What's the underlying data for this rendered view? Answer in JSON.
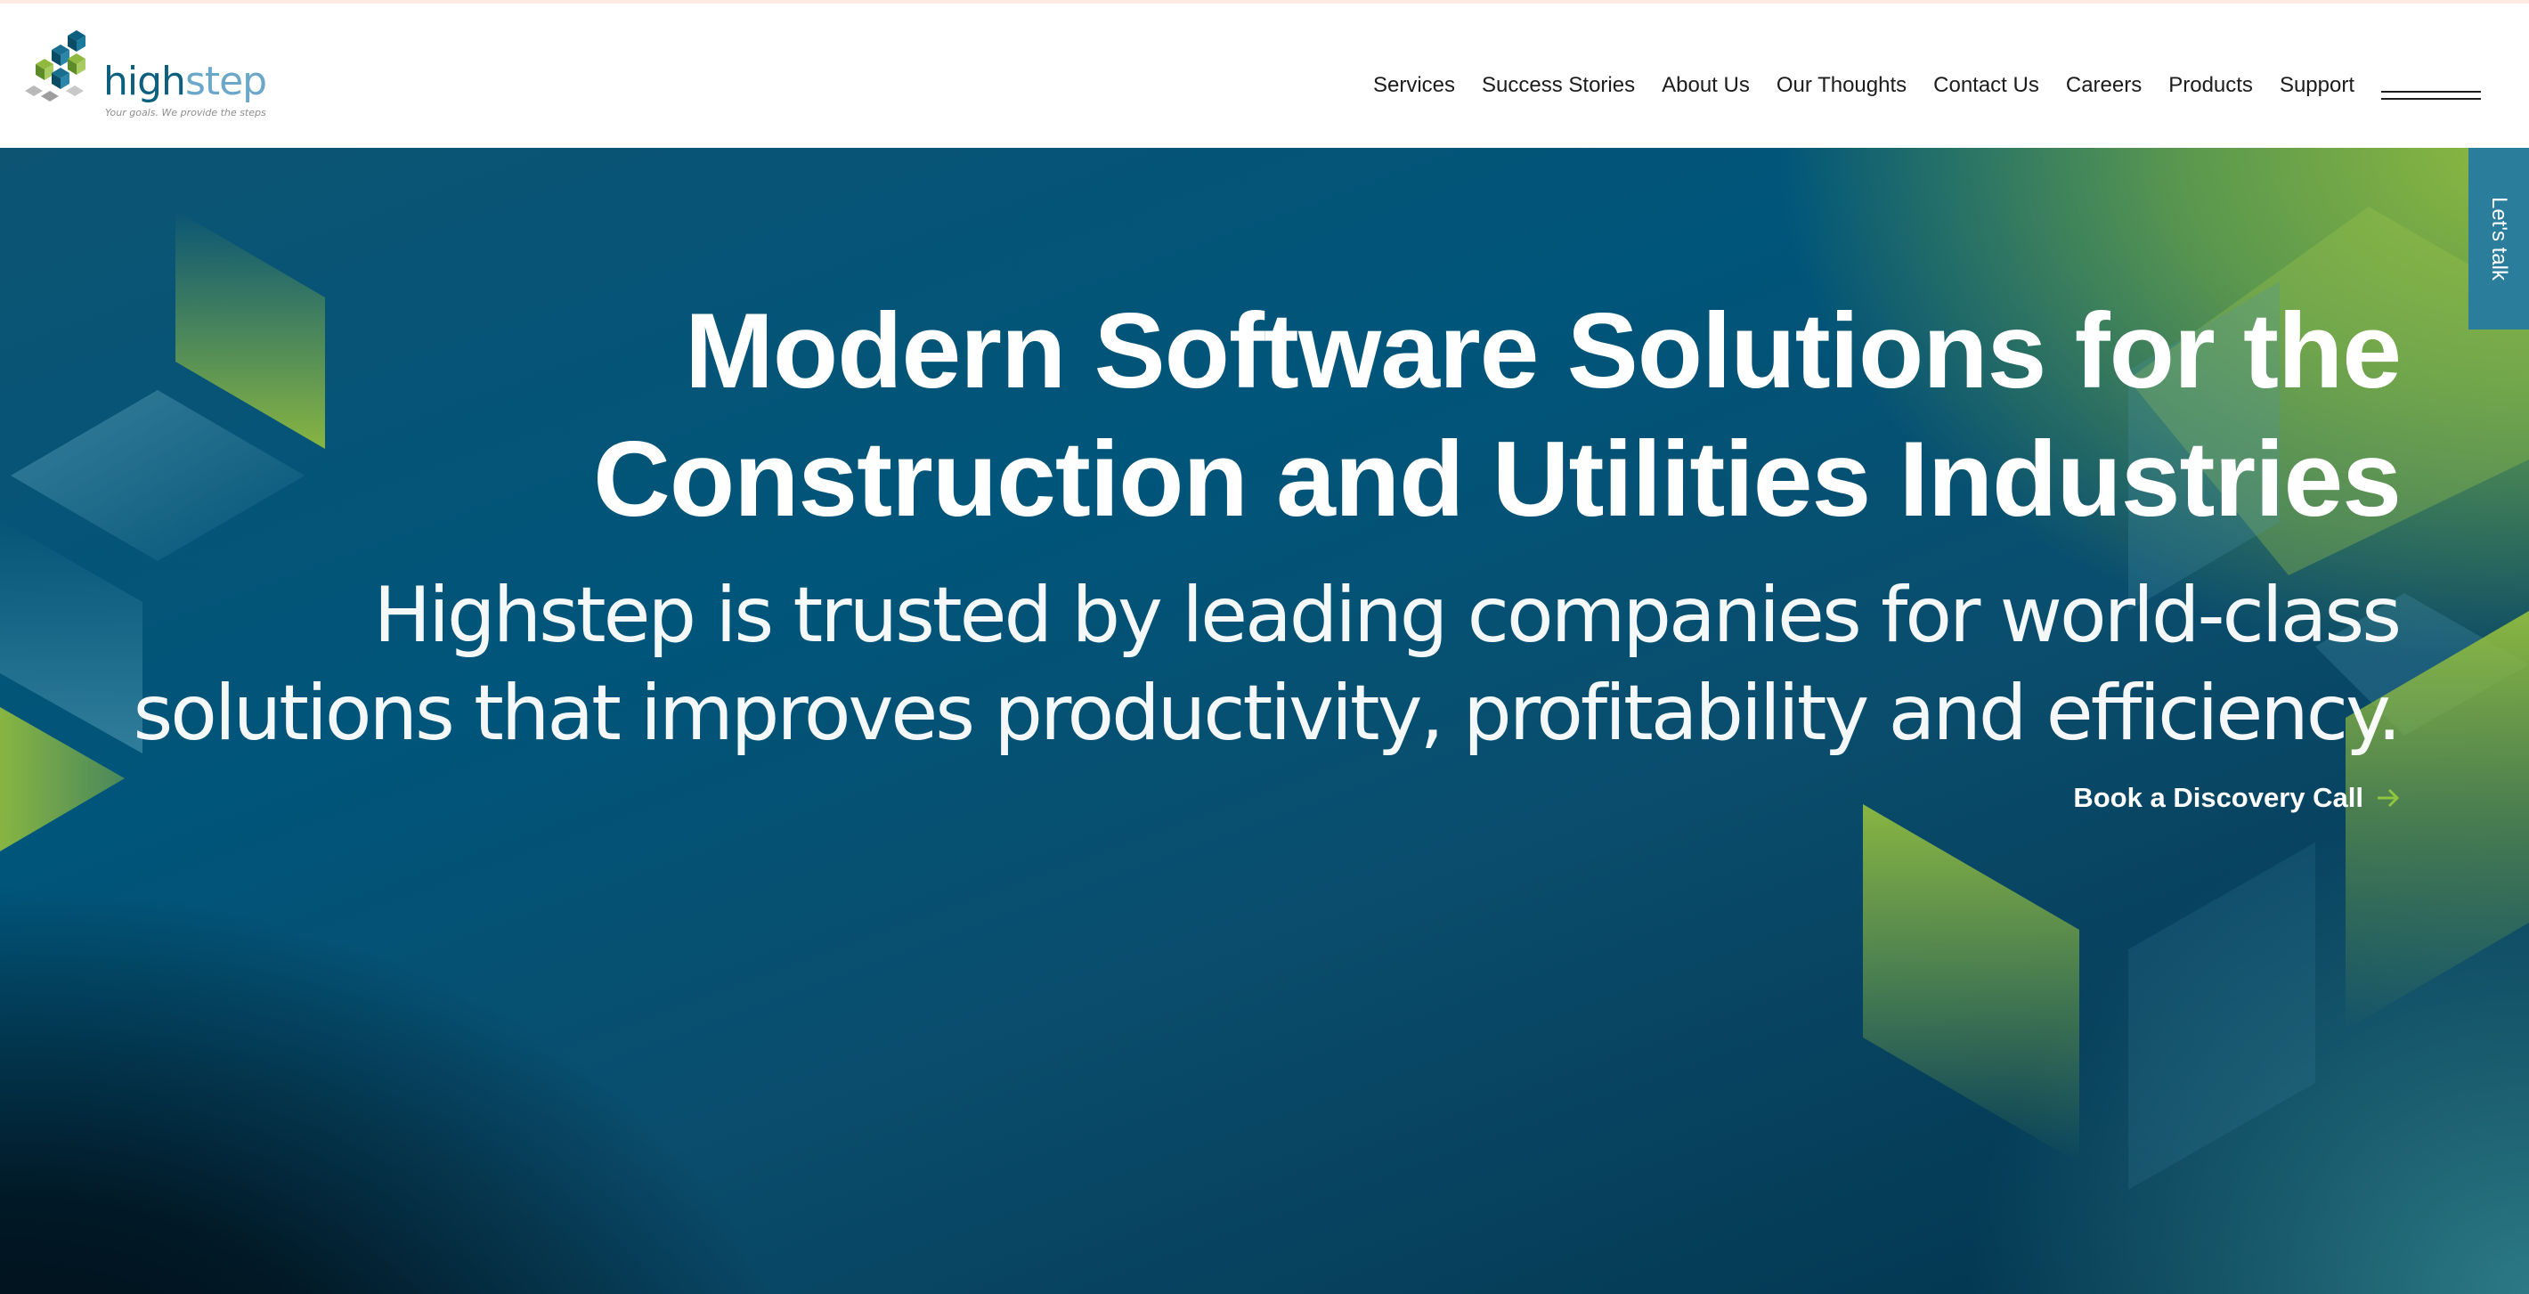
{
  "header": {
    "logo": {
      "word_part1": "high",
      "word_part2": "step",
      "tagline": "Your goals. We provide the steps"
    },
    "nav": [
      {
        "label": "Services"
      },
      {
        "label": "Success Stories"
      },
      {
        "label": "About Us"
      },
      {
        "label": "Our Thoughts"
      },
      {
        "label": "Contact Us"
      },
      {
        "label": "Careers"
      },
      {
        "label": "Products"
      },
      {
        "label": "Support"
      }
    ],
    "menu_icon": "hamburger-menu-icon"
  },
  "hero": {
    "title_line1": "Modern Software Solutions for the",
    "title_line2": "Construction and Utilities Industries",
    "subtitle_line1": "Highstep is trusted by leading companies for world-class",
    "subtitle_line2": "solutions that improves productivity, profitability and efficiency.",
    "cta_label": "Book a Discovery Call",
    "cta_icon": "arrow-right-icon"
  },
  "side_tab": {
    "label": "Let's talk"
  },
  "colors": {
    "brand_dark_blue": "#0d5f7f",
    "brand_light_blue": "#6aa7c8",
    "brand_green": "#8fba3f",
    "side_tab": "#2b7e9b",
    "cta_arrow": "#8fc43f"
  }
}
